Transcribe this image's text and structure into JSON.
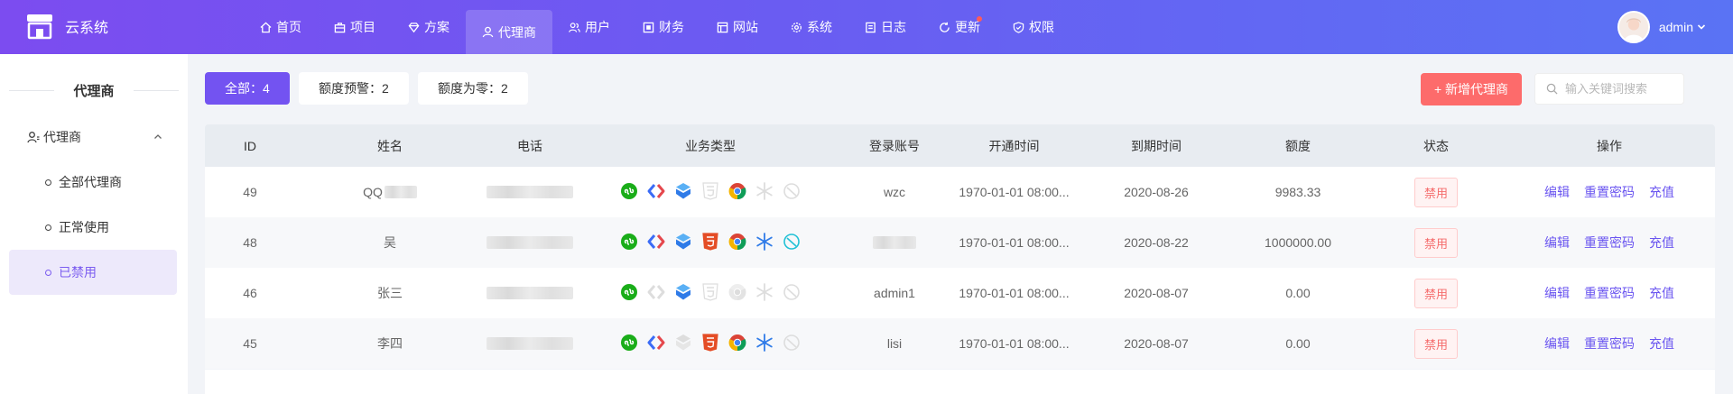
{
  "brand": {
    "name": "云系统"
  },
  "nav": [
    {
      "label": "首页",
      "icon": "home-icon"
    },
    {
      "label": "项目",
      "icon": "briefcase-icon"
    },
    {
      "label": "方案",
      "icon": "diamond-icon"
    },
    {
      "label": "代理商",
      "icon": "user-icon",
      "active": true
    },
    {
      "label": "用户",
      "icon": "users-icon"
    },
    {
      "label": "财务",
      "icon": "finance-icon"
    },
    {
      "label": "网站",
      "icon": "website-icon"
    },
    {
      "label": "系统",
      "icon": "gear-icon"
    },
    {
      "label": "日志",
      "icon": "log-icon"
    },
    {
      "label": "更新",
      "icon": "refresh-icon",
      "badge_dot": true
    },
    {
      "label": "权限",
      "icon": "shield-icon"
    }
  ],
  "user": {
    "name": "admin"
  },
  "sidebar": {
    "title": "代理商",
    "group": "代理商",
    "items": [
      {
        "label": "全部代理商"
      },
      {
        "label": "正常使用"
      },
      {
        "label": "已禁用",
        "active": true
      }
    ]
  },
  "filters": [
    {
      "label": "全部：4",
      "active": true
    },
    {
      "label": "额度预警：2"
    },
    {
      "label": "额度为零：2"
    }
  ],
  "add_button": "+ 新增代理商",
  "search": {
    "placeholder": "输入关键词搜索"
  },
  "table": {
    "headers": [
      "ID",
      "姓名",
      "电话",
      "业务类型",
      "登录账号",
      "开通时间",
      "到期时间",
      "额度",
      "状态",
      "操作"
    ],
    "rows": [
      {
        "id": "49",
        "name": "QQ",
        "name_blurred": true,
        "account": "wzc",
        "start": "1970-01-01 08:00...",
        "end": "2020-08-26",
        "quota": "9983.33",
        "status": "禁用",
        "active_icons": [
          true,
          true,
          true,
          false,
          true,
          false,
          false
        ]
      },
      {
        "id": "48",
        "name": "吴",
        "name_blurred": false,
        "account": "",
        "start": "1970-01-01 08:00...",
        "end": "2020-08-22",
        "quota": "1000000.00",
        "status": "禁用",
        "active_icons": [
          true,
          true,
          true,
          true,
          true,
          true,
          true
        ]
      },
      {
        "id": "46",
        "name": "张三",
        "name_blurred": false,
        "account": "admin1",
        "start": "1970-01-01 08:00...",
        "end": "2020-08-07",
        "quota": "0.00",
        "status": "禁用",
        "active_icons": [
          true,
          false,
          true,
          false,
          false,
          false,
          false
        ]
      },
      {
        "id": "45",
        "name": "李四",
        "name_blurred": false,
        "account": "lisi",
        "start": "1970-01-01 08:00...",
        "end": "2020-08-07",
        "quota": "0.00",
        "status": "禁用",
        "active_icons": [
          true,
          true,
          false,
          true,
          true,
          true,
          false
        ]
      }
    ],
    "actions": [
      "编辑",
      "重置密码",
      "充值"
    ],
    "business_icons": [
      "miniprogram-icon",
      "code-icon",
      "cube-icon",
      "html5-icon",
      "chrome-icon",
      "snowflake-icon",
      "leaf-icon"
    ]
  },
  "colors": {
    "accent": "#7353f1",
    "danger": "#fd6b6b",
    "link": "#6a55f0"
  }
}
